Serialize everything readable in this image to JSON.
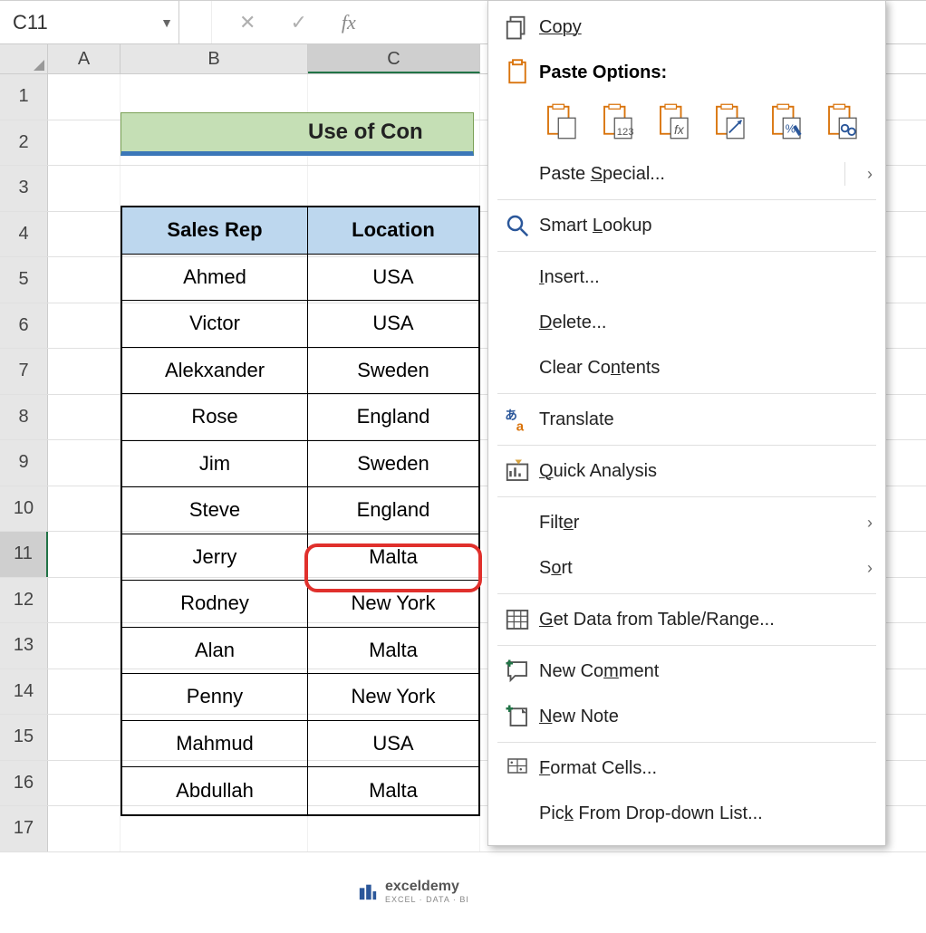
{
  "name_box": {
    "value": "C11"
  },
  "fx_label": "fx",
  "columns": [
    "A",
    "B",
    "C"
  ],
  "active_column": "C",
  "row_numbers": [
    1,
    2,
    3,
    4,
    5,
    6,
    7,
    8,
    9,
    10,
    11,
    12,
    13,
    14,
    15,
    16,
    17
  ],
  "active_row": 11,
  "title_text": "Use of Con",
  "table": {
    "headers": {
      "b": "Sales Rep",
      "c": "Location"
    },
    "rows": [
      {
        "b": "Ahmed",
        "c": "USA"
      },
      {
        "b": "Victor",
        "c": "USA"
      },
      {
        "b": "Alekxander",
        "c": "Sweden"
      },
      {
        "b": "Rose",
        "c": "England"
      },
      {
        "b": "Jim",
        "c": "Sweden"
      },
      {
        "b": "Steve",
        "c": "England"
      },
      {
        "b": "Jerry",
        "c": "Malta"
      },
      {
        "b": "Rodney",
        "c": "New York"
      },
      {
        "b": "Alan",
        "c": "Malta"
      },
      {
        "b": "Penny",
        "c": "New York"
      },
      {
        "b": "Mahmud",
        "c": "USA"
      },
      {
        "b": "Abdullah",
        "c": "Malta"
      }
    ]
  },
  "selected_cell_highlight_row_index": 6,
  "context_menu": {
    "copy": "Copy",
    "paste_options_header": "Paste Options:",
    "paste_special": "Paste Special...",
    "smart_lookup": "Smart Lookup",
    "insert": "Insert...",
    "delete": "Delete...",
    "clear_contents": "Clear Contents",
    "translate": "Translate",
    "quick_analysis": "Quick Analysis",
    "filter": "Filter",
    "sort": "Sort",
    "get_data": "Get Data from Table/Range...",
    "new_comment": "New Comment",
    "new_note": "New Note",
    "format_cells": "Format Cells...",
    "pick_list": "Pick From Drop-down List..."
  },
  "colors": {
    "clipboard_orange": "#d9730b",
    "icon_blue": "#2b579a"
  },
  "watermark": {
    "name": "exceldemy",
    "sub": "EXCEL · DATA · BI"
  }
}
